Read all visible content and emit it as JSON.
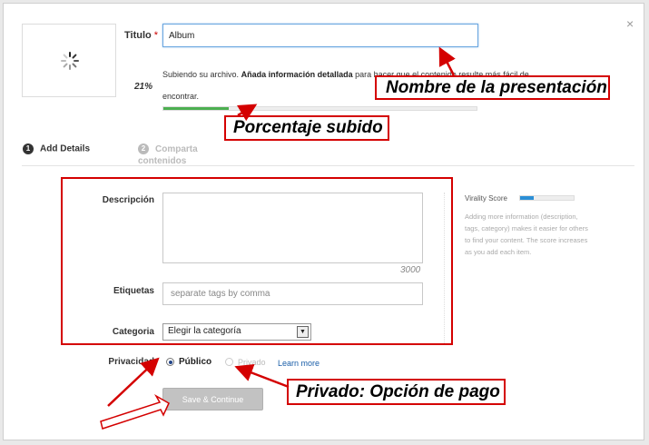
{
  "dialog": {
    "close_glyph": "×",
    "title_label": "Titulo",
    "title_required": "*",
    "title_value": "Album",
    "upload_prefix": "Subiendo su archivo.",
    "upload_bold": "Añada información detallada",
    "upload_suffix": "para hacer que el contenido resulte más fácil de encontrar.",
    "upload_percent": "21%",
    "upload_progress": 0.21
  },
  "steps": [
    {
      "number": "1",
      "label": "Add Details"
    },
    {
      "number": "2",
      "label": "Comparta contenidos"
    }
  ],
  "form": {
    "description_label": "Descripción",
    "description_counter": "3000",
    "tags_label": "Etiquetas",
    "tags_placeholder": "separate tags by comma",
    "category_label": "Categoria",
    "category_value": "Elegir la categoría",
    "privacy_label": "Privacidad",
    "privacy_public": "Público",
    "privacy_private": "Privado",
    "learn_more": "Learn more",
    "save_button": "Save & Continue"
  },
  "virality": {
    "label": "Virality Score",
    "level": 0.25,
    "help": "Adding more information (description, tags, category) makes it easier for others to find your content. The score increases as you add each item."
  },
  "annotations": {
    "nombre": "Nombre de la presentación",
    "porcentaje": "Porcentaje subido",
    "privado": "Privado: Opción de pago"
  },
  "colors": {
    "annotation_red": "#d40000",
    "progress_green": "#4caf50",
    "virality_blue": "#2b8fd6",
    "link_blue": "#1a5ea8"
  }
}
